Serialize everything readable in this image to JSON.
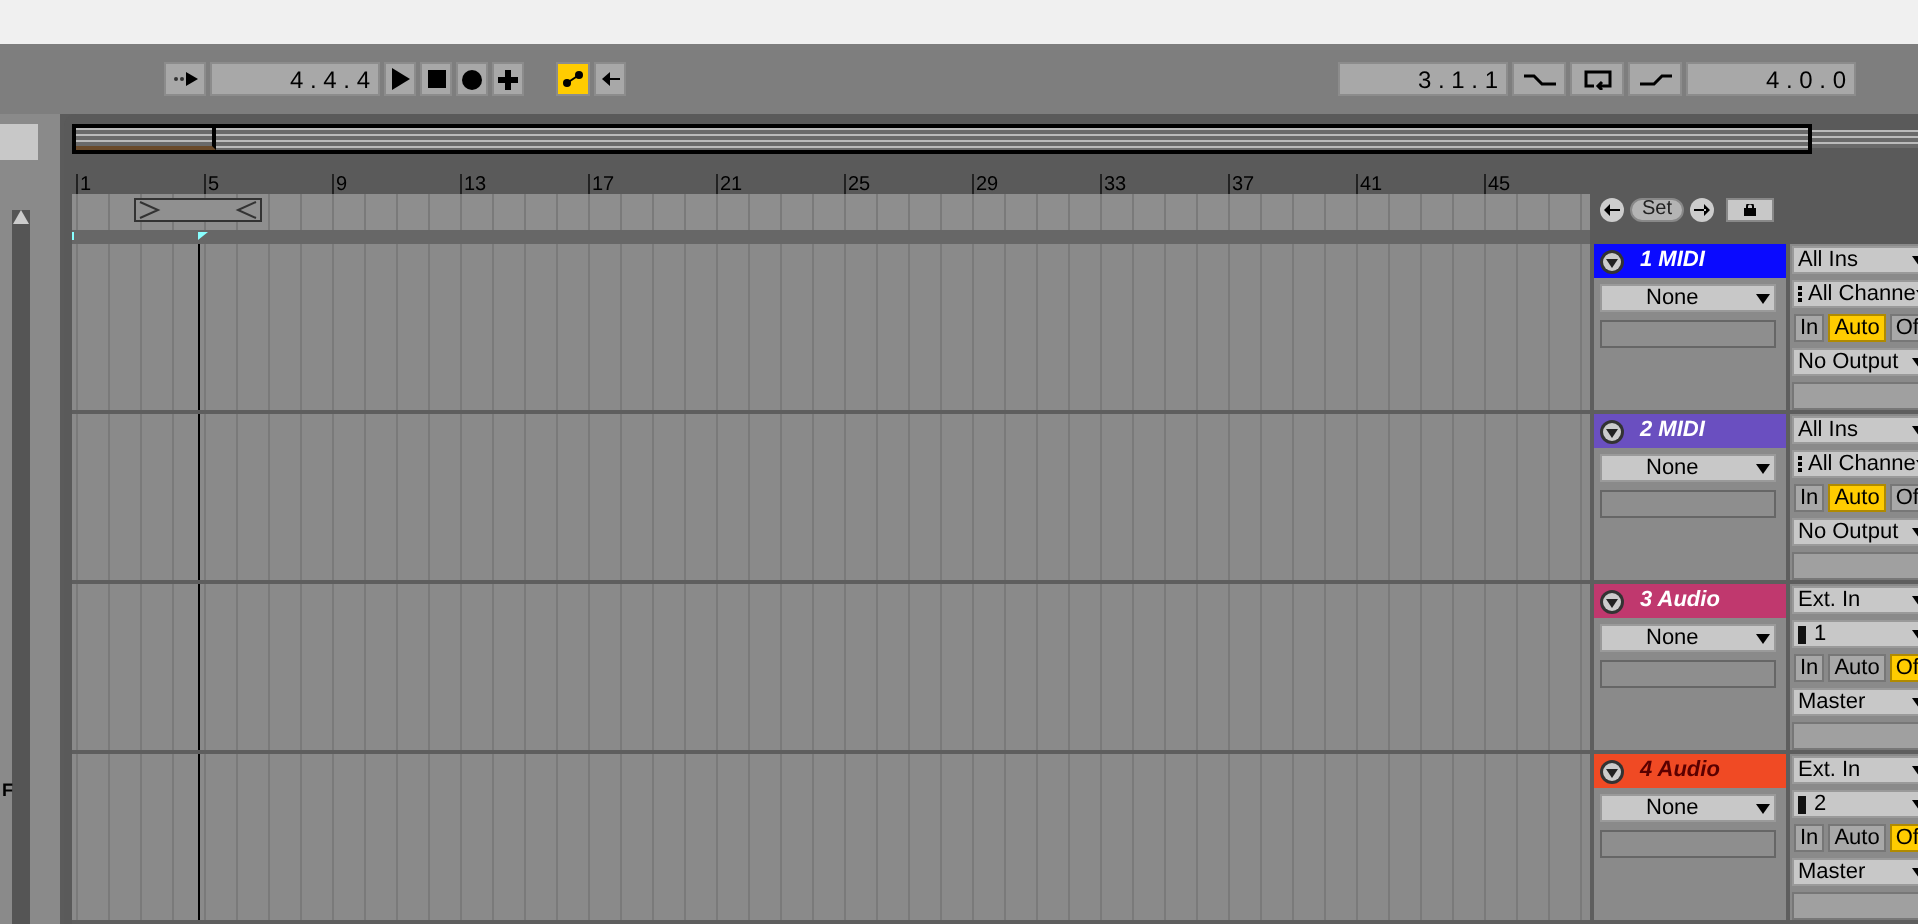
{
  "left_panel": {
    "label": "F"
  },
  "transport": {
    "position": "4 . 4 . 4",
    "buttons": [
      {
        "kind": "play"
      },
      {
        "kind": "stop"
      },
      {
        "kind": "record"
      },
      {
        "kind": "add"
      }
    ],
    "draw_mode": {
      "on": true
    }
  },
  "loop": {
    "start": "3 . 1 . 1",
    "punch_in": {
      "on": false
    },
    "loop_switch": {
      "on": false
    },
    "punch_out": {
      "on": false
    },
    "length": "4 . 0 . 0"
  },
  "ruler": {
    "bars": [
      "1",
      "5",
      "9",
      "13",
      "17",
      "21",
      "25",
      "29",
      "33",
      "37",
      "41",
      "45"
    ]
  },
  "locators": {
    "set": "Set"
  },
  "tracks": [
    {
      "name": "1 MIDI",
      "kind": "midi",
      "color": "#0a0aff",
      "clip": "None",
      "input": "All Ins",
      "channel": "All Channe",
      "monitor": [
        {
          "label": "In",
          "selected": false
        },
        {
          "label": "Auto",
          "selected": true
        },
        {
          "label": "Of",
          "selected": false
        }
      ],
      "output": "No Output"
    },
    {
      "name": "2 MIDI",
      "kind": "midi",
      "color": "#6a4fc0",
      "clip": "None",
      "input": "All Ins",
      "channel": "All Channe",
      "monitor": [
        {
          "label": "In",
          "selected": false
        },
        {
          "label": "Auto",
          "selected": true
        },
        {
          "label": "Of",
          "selected": false
        }
      ],
      "output": "No Output"
    },
    {
      "name": "3 Audio",
      "kind": "audio",
      "color": "#c0386e",
      "clip": "None",
      "input": "Ext. In",
      "channel": "1",
      "monitor": [
        {
          "label": "In",
          "selected": false
        },
        {
          "label": "Auto",
          "selected": false
        },
        {
          "label": "Of",
          "selected": true
        }
      ],
      "output": "Master"
    },
    {
      "name": "4 Audio",
      "kind": "audio",
      "color": "#f04a24",
      "clip": "None",
      "input": "Ext. In",
      "channel": "2",
      "monitor": [
        {
          "label": "In",
          "selected": false
        },
        {
          "label": "Auto",
          "selected": false
        },
        {
          "label": "Of",
          "selected": true
        }
      ],
      "output": "Master"
    }
  ]
}
